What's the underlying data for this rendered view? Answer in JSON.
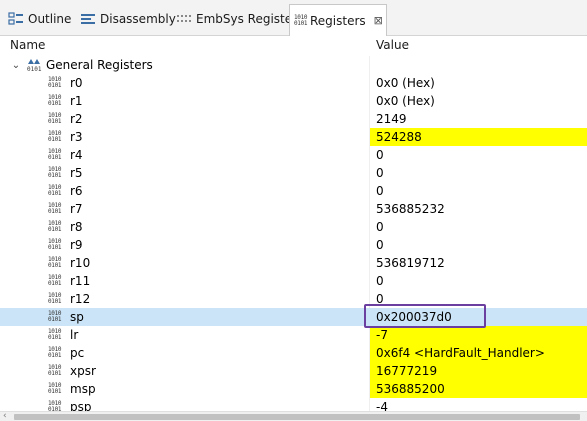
{
  "tabs": [
    {
      "label": "Outline",
      "icon": "outline-icon",
      "active": false
    },
    {
      "label": "Disassembly",
      "icon": "disassembly-icon",
      "active": false
    },
    {
      "label": "EmbSys Registers",
      "icon": "embsys-registers-icon",
      "active": false
    },
    {
      "label": "Registers",
      "icon": "registers-icon",
      "active": true,
      "close": "⊠"
    }
  ],
  "columns": {
    "name": "Name",
    "value": "Value"
  },
  "group": {
    "label": "General Registers",
    "expanded": true
  },
  "registers": [
    {
      "name": "r0",
      "value": "0x0 (Hex)",
      "highlight": false
    },
    {
      "name": "r1",
      "value": "0x0 (Hex)",
      "highlight": false
    },
    {
      "name": "r2",
      "value": "2149",
      "highlight": false
    },
    {
      "name": "r3",
      "value": "524288",
      "highlight": true
    },
    {
      "name": "r4",
      "value": "0",
      "highlight": false
    },
    {
      "name": "r5",
      "value": "0",
      "highlight": false
    },
    {
      "name": "r6",
      "value": "0",
      "highlight": false
    },
    {
      "name": "r7",
      "value": "536885232",
      "highlight": false
    },
    {
      "name": "r8",
      "value": "0",
      "highlight": false
    },
    {
      "name": "r9",
      "value": "0",
      "highlight": false
    },
    {
      "name": "r10",
      "value": "536819712",
      "highlight": false
    },
    {
      "name": "r11",
      "value": "0",
      "highlight": false
    },
    {
      "name": "r12",
      "value": "0",
      "highlight": false
    },
    {
      "name": "sp",
      "value": "0x200037d0",
      "highlight": false,
      "selected": true
    },
    {
      "name": "lr",
      "value": "-7",
      "highlight": true
    },
    {
      "name": "pc",
      "value": "0x6f4 <HardFault_Handler>",
      "highlight": true
    },
    {
      "name": "xpsr",
      "value": "16777219",
      "highlight": true
    },
    {
      "name": "msp",
      "value": "536885200",
      "highlight": true
    },
    {
      "name": "psp",
      "value": "-4",
      "highlight": false
    }
  ],
  "colors": {
    "highlight": "#ffff00",
    "selection": "#cce4f7",
    "annotation": "#6b3fa0"
  }
}
